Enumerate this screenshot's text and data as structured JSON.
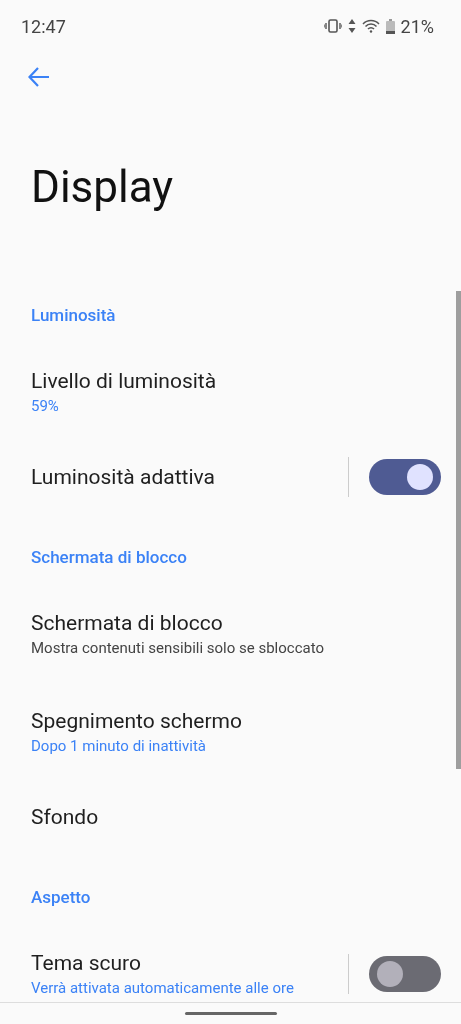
{
  "status_bar": {
    "time": "12:47",
    "battery": "21%"
  },
  "title": "Display",
  "sections": [
    {
      "header": "Luminosità",
      "items": [
        {
          "kind": "plain",
          "title": "Livello di luminosità",
          "subtitle": "59%",
          "subtitle_accent": true
        },
        {
          "kind": "switch",
          "title": "Luminosità adattiva",
          "on": true
        }
      ]
    },
    {
      "header": "Schermata di blocco",
      "items": [
        {
          "kind": "plain",
          "title": "Schermata di blocco",
          "subtitle": "Mostra contenuti sensibili solo se sbloccato",
          "subtitle_accent": false
        },
        {
          "kind": "plain",
          "title": "Spegnimento schermo",
          "subtitle": "Dopo 1 minuto di inattività",
          "subtitle_accent": true
        },
        {
          "kind": "plain",
          "title": "Sfondo"
        }
      ]
    },
    {
      "header": "Aspetto",
      "items": [
        {
          "kind": "switch",
          "title": "Tema scuro",
          "subtitle": "Verrà attivata automaticamente alle ore",
          "subtitle_accent": true,
          "on": false
        }
      ]
    }
  ]
}
